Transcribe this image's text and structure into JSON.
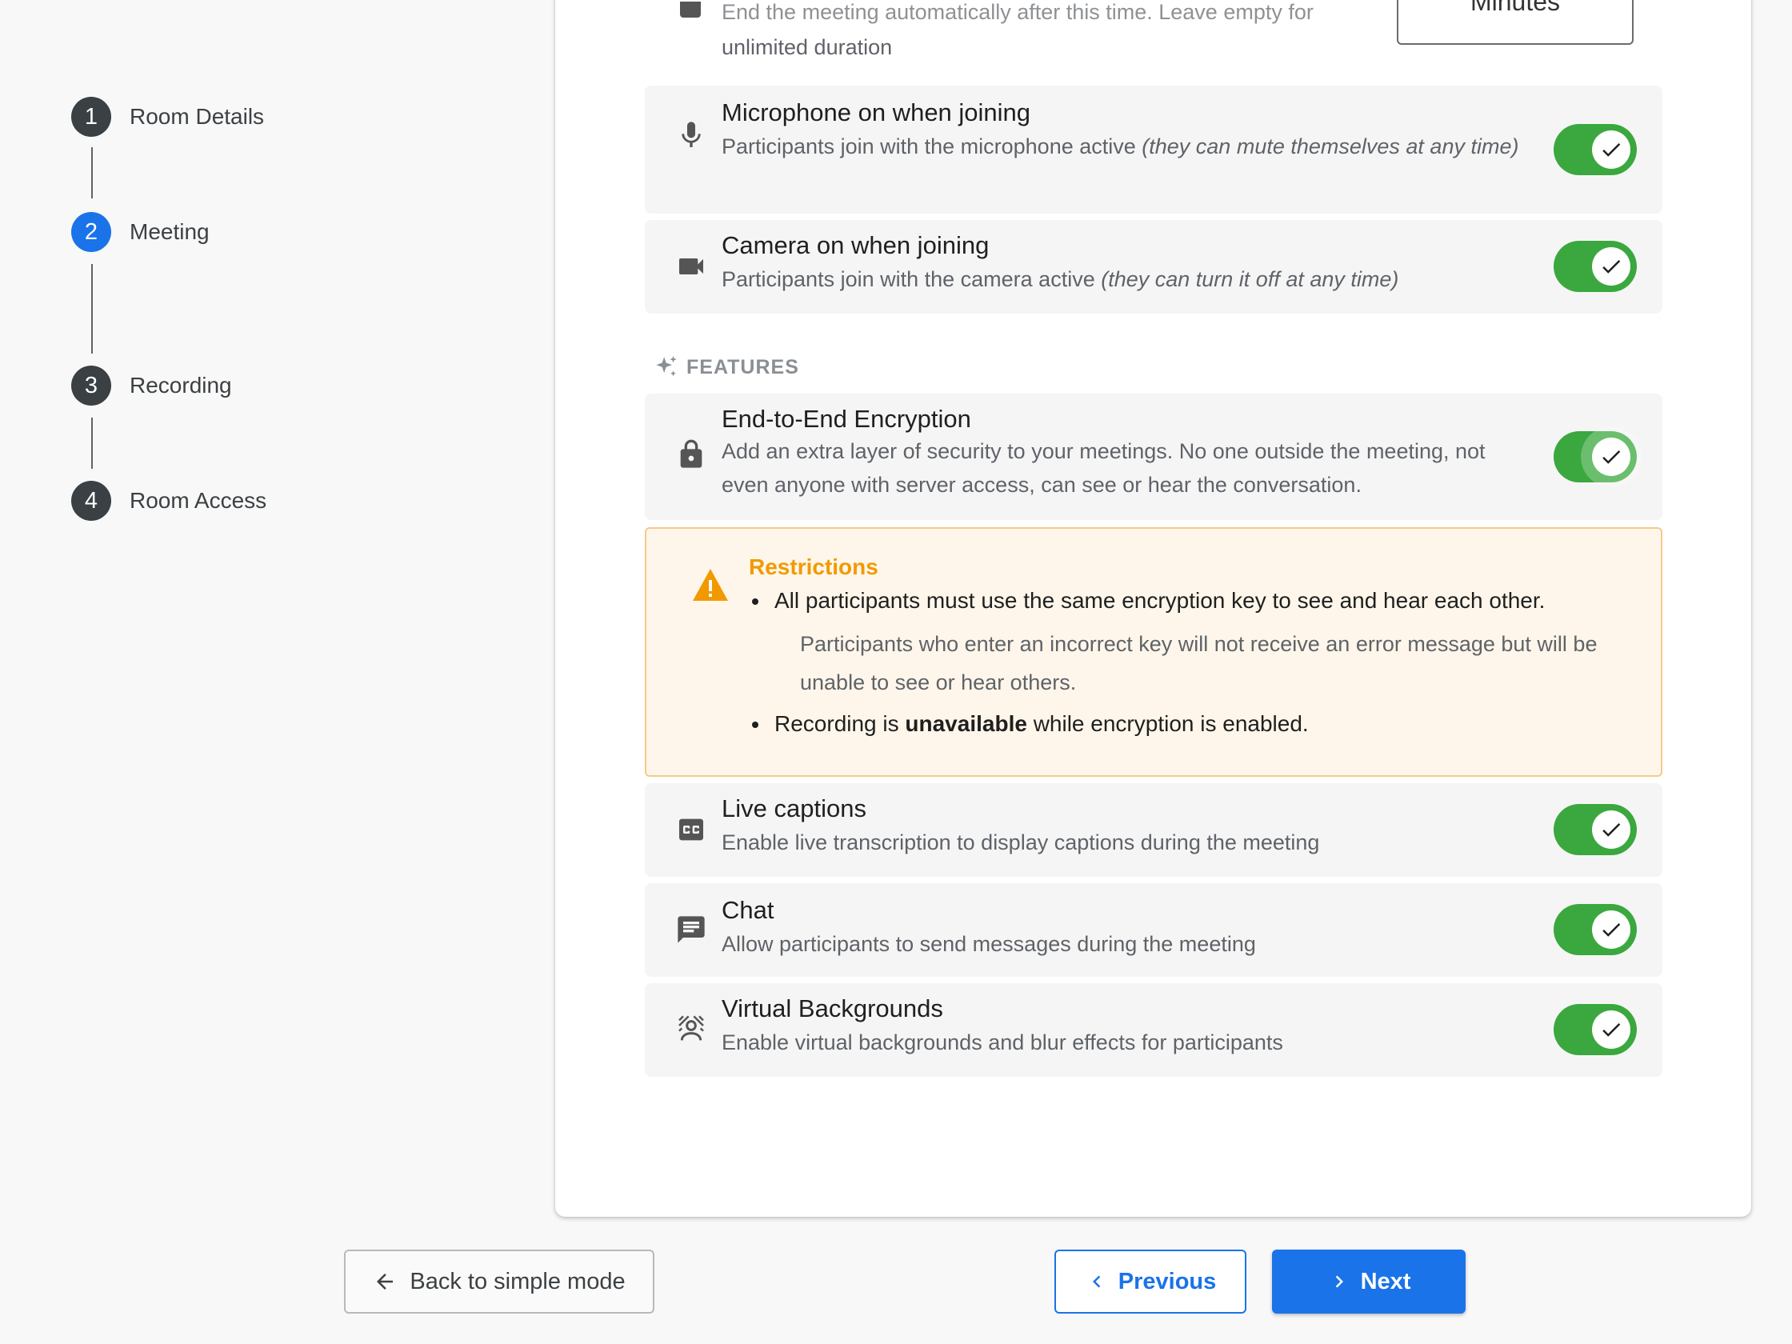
{
  "stepper": {
    "steps": [
      {
        "number": "1",
        "label": "Room Details"
      },
      {
        "number": "2",
        "label": "Meeting",
        "active": true
      },
      {
        "number": "3",
        "label": "Recording"
      },
      {
        "number": "4",
        "label": "Room Access"
      }
    ]
  },
  "top_partial": {
    "description_line1": "End the meeting automatically after this time. Leave empty for",
    "description_line2": "unlimited duration",
    "duration_unit": "Minutes"
  },
  "settings": {
    "microphone": {
      "title": "Microphone on when joining",
      "desc": "Participants join with the microphone active ",
      "desc_italic": "(they can mute themselves at any time)",
      "enabled": true,
      "icon": "mic-icon"
    },
    "camera": {
      "title": "Camera on when joining",
      "desc": "Participants join with the camera active ",
      "desc_italic": "(they can turn it off at any time)",
      "enabled": true,
      "icon": "videocam-icon"
    }
  },
  "features": {
    "heading": "FEATURES",
    "icon": "sparkle-icon",
    "encryption": {
      "title": "End-to-End Encryption",
      "desc": "Add an extra layer of security to your meetings. No one outside the meeting, not even anyone with server access, can see or hear the conversation.",
      "enabled": true,
      "icon": "lock-icon"
    },
    "restrictions": {
      "title": "Restrictions",
      "item1": "All participants must use the same encryption key to see and hear each other.",
      "item1_sub": "Participants who enter an incorrect key will not receive an error message but will be unable to see or hear others.",
      "item2_pre": "Recording is ",
      "item2_bold": "unavailable",
      "item2_post": " while encryption is enabled.",
      "icon": "warning-icon"
    },
    "captions": {
      "title": "Live captions",
      "desc": "Enable live transcription to display captions during the meeting",
      "enabled": true,
      "icon": "closed-caption-icon"
    },
    "chat": {
      "title": "Chat",
      "desc": "Allow participants to send messages during the meeting",
      "enabled": true,
      "icon": "chat-icon"
    },
    "backgrounds": {
      "title": "Virtual Backgrounds",
      "desc": "Enable virtual backgrounds and blur effects for participants",
      "enabled": true,
      "icon": "background-replace-icon"
    }
  },
  "buttons": {
    "back": "Back to simple mode",
    "previous": "Previous",
    "next": "Next"
  },
  "colors": {
    "accent": "#1a73e8",
    "toggle_on": "#3aa83e",
    "warning": "#f29900",
    "warning_bg": "#fef6ea"
  }
}
